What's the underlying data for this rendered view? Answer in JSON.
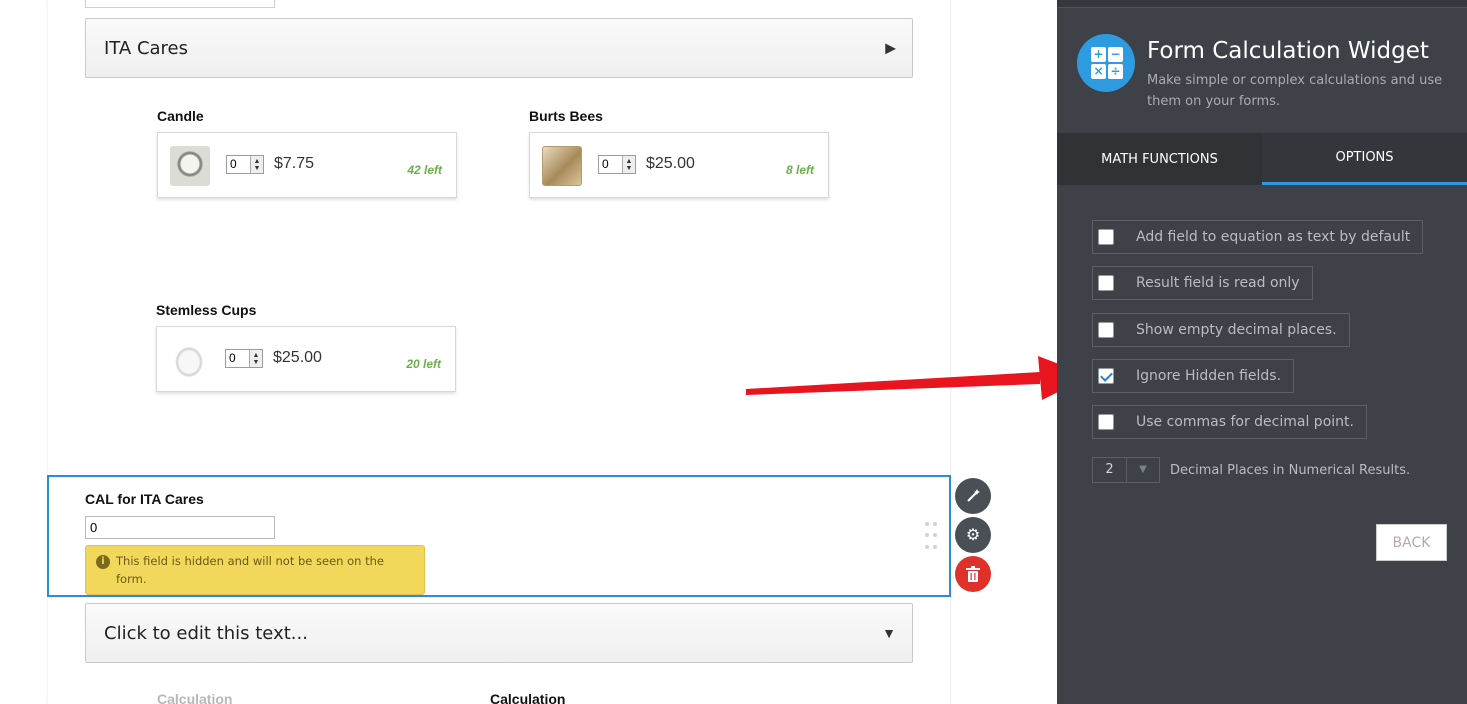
{
  "form": {
    "section_title": "ITA Cares",
    "products": [
      {
        "name": "Candle",
        "qty": "0",
        "price": "$7.75",
        "left": "42 left"
      },
      {
        "name": "Burts Bees",
        "qty": "0",
        "price": "$25.00",
        "left": "8 left"
      },
      {
        "name": "Stemless Cups",
        "qty": "0",
        "price": "$25.00",
        "left": "20 left"
      }
    ],
    "cal_field": {
      "label": "CAL for ITA Cares",
      "value": "0",
      "hidden_note": "This field is hidden and will not be seen on the form."
    },
    "text_header": "Click to edit this text...",
    "calc_headings": [
      "Calculation",
      "Calculation"
    ]
  },
  "panel": {
    "title": "Form Calculation Widget",
    "subtitle": "Make simple or complex calculations and use them on your forms.",
    "tabs": [
      "MATH FUNCTIONS",
      "OPTIONS"
    ],
    "active_tab": "OPTIONS",
    "options": [
      {
        "label": "Add field to equation as text by default",
        "checked": false
      },
      {
        "label": "Result field is read only",
        "checked": false
      },
      {
        "label": "Show empty decimal places.",
        "checked": false
      },
      {
        "label": "Ignore Hidden fields.",
        "checked": true
      },
      {
        "label": "Use commas for decimal point.",
        "checked": false
      }
    ],
    "decimal_places": {
      "value": "2",
      "label": "Decimal Places in Numerical Results."
    },
    "back_label": "BACK"
  },
  "colors": {
    "panel_bg": "#3e4147",
    "accent": "#2c9be0",
    "selection_border": "#2a8fcf",
    "stock_green": "#6ab04c",
    "warning_yellow": "#f2d85a",
    "delete_red": "#e0302a",
    "annotation_arrow": "#e8141e"
  },
  "icons": [
    "calculator-icon",
    "magic-wand-icon",
    "gear-icon",
    "trash-icon",
    "info-icon",
    "chevron-right-icon",
    "chevron-down-icon",
    "checkmark-icon",
    "red-arrow-annotation"
  ]
}
